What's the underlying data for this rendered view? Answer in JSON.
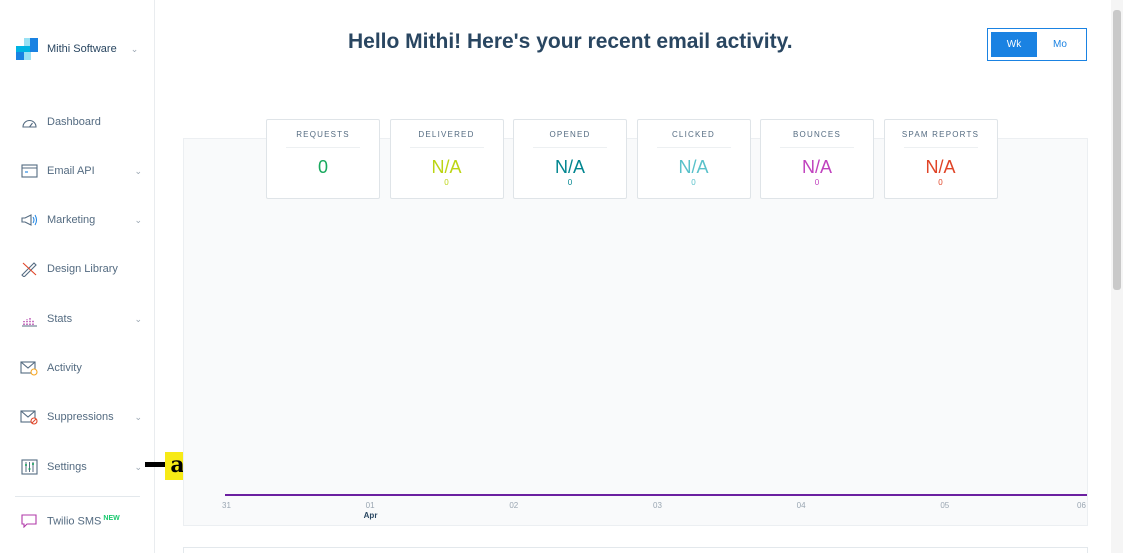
{
  "account": {
    "name": "Mithi Software"
  },
  "nav": {
    "items": [
      {
        "label": "Dashboard",
        "icon": "gauge-icon",
        "chevron": false
      },
      {
        "label": "Email API",
        "icon": "email-api-icon",
        "chevron": true
      },
      {
        "label": "Marketing",
        "icon": "megaphone-icon",
        "chevron": true
      },
      {
        "label": "Design Library",
        "icon": "design-tools-icon",
        "chevron": false
      },
      {
        "label": "Stats",
        "icon": "stats-icon",
        "chevron": true
      },
      {
        "label": "Activity",
        "icon": "activity-envelope-icon",
        "chevron": false
      },
      {
        "label": "Suppressions",
        "icon": "suppressions-envelope-icon",
        "chevron": true
      },
      {
        "label": "Settings",
        "icon": "settings-sliders-icon",
        "chevron": true
      }
    ],
    "twilio": {
      "label": "Twilio SMS",
      "badge": "NEW"
    }
  },
  "annotation": {
    "label": "a"
  },
  "header": {
    "title": "Hello Mithi! Here's your recent email activity.",
    "toggle": {
      "week": "Wk",
      "month": "Mo",
      "selected": "Wk"
    }
  },
  "stats": [
    {
      "label": "REQUESTS",
      "value": "0",
      "count": "",
      "color": "#18a95e"
    },
    {
      "label": "DELIVERED",
      "value": "N/A",
      "count": "0",
      "color": "#bcd514"
    },
    {
      "label": "OPENED",
      "value": "N/A",
      "count": "0",
      "color": "#028690"
    },
    {
      "label": "CLICKED",
      "value": "N/A",
      "count": "0",
      "color": "#59c1ca"
    },
    {
      "label": "BOUNCES",
      "value": "N/A",
      "count": "0",
      "color": "#c042be"
    },
    {
      "label": "SPAM REPORTS",
      "value": "N/A",
      "count": "0",
      "color": "#e04427"
    }
  ],
  "chart_data": {
    "type": "line",
    "x": [
      "31",
      "01",
      "02",
      "03",
      "04",
      "05",
      "06"
    ],
    "x_sub": {
      "01": "Apr"
    },
    "series": [
      {
        "values": [
          0,
          0,
          0,
          0,
          0,
          0,
          0
        ],
        "color": "#6b1fa0"
      }
    ],
    "grid": false
  }
}
